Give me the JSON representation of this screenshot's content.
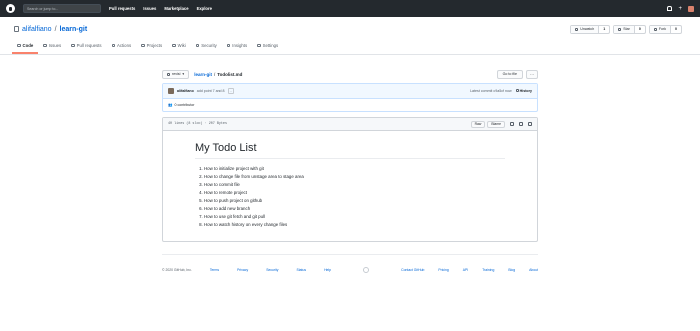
{
  "topbar": {
    "search_placeholder": "Search or jump to...",
    "nav": [
      "Pull requests",
      "Issues",
      "Marketplace",
      "Explore"
    ],
    "icons": [
      "github-mark",
      "bell-icon",
      "plus-icon",
      "avatar"
    ]
  },
  "repo": {
    "owner": "alifalfiano",
    "separator": "/",
    "name": "learn-git",
    "unwatch_label": "Unwatch",
    "unwatch_count": "1",
    "star_label": "Star",
    "star_count": "0",
    "fork_label": "Fork",
    "fork_count": "0"
  },
  "tabs": [
    {
      "label": "Code",
      "icon": "code-icon"
    },
    {
      "label": "Issues",
      "icon": "issue-icon"
    },
    {
      "label": "Pull requests",
      "icon": "pr-icon"
    },
    {
      "label": "Actions",
      "icon": "play-icon"
    },
    {
      "label": "Projects",
      "icon": "project-icon"
    },
    {
      "label": "Wiki",
      "icon": "book-icon"
    },
    {
      "label": "Security",
      "icon": "shield-icon"
    },
    {
      "label": "Insights",
      "icon": "graph-icon"
    },
    {
      "label": "Settings",
      "icon": "gear-icon"
    }
  ],
  "filenav": {
    "branch": "revisi",
    "repo_crumb": "learn-git",
    "sep": "/",
    "file": "Todolist.md",
    "goto_label": "Go to file",
    "more_label": "···"
  },
  "commit": {
    "author": "alifalfiano",
    "message": "add point 7 and 8",
    "ellipsis": "···",
    "latest": "Latest commit c9a5cf now",
    "history": "History",
    "contributors": "0 contributor",
    "contributors_count": "0"
  },
  "file": {
    "meta": "40 lines (8 sloc)  ·  207 Bytes",
    "raw": "Raw",
    "blame": "Blame"
  },
  "markdown": {
    "title": "My Todo List",
    "items": [
      "How to initialize project with git",
      "How to change file from unstage area to stage area",
      "How to commit file",
      "How to remote project",
      "How to push project on github",
      "How to add new branch",
      "How to use git fetch and git pull",
      "How to watch history on every change files"
    ]
  },
  "footer": {
    "copyright": "© 2020 GitHub, Inc.",
    "left_links": [
      "Terms",
      "Privacy",
      "Security",
      "Status",
      "Help"
    ],
    "right_links": [
      "Contact GitHub",
      "Pricing",
      "API",
      "Training",
      "Blog",
      "About"
    ]
  }
}
